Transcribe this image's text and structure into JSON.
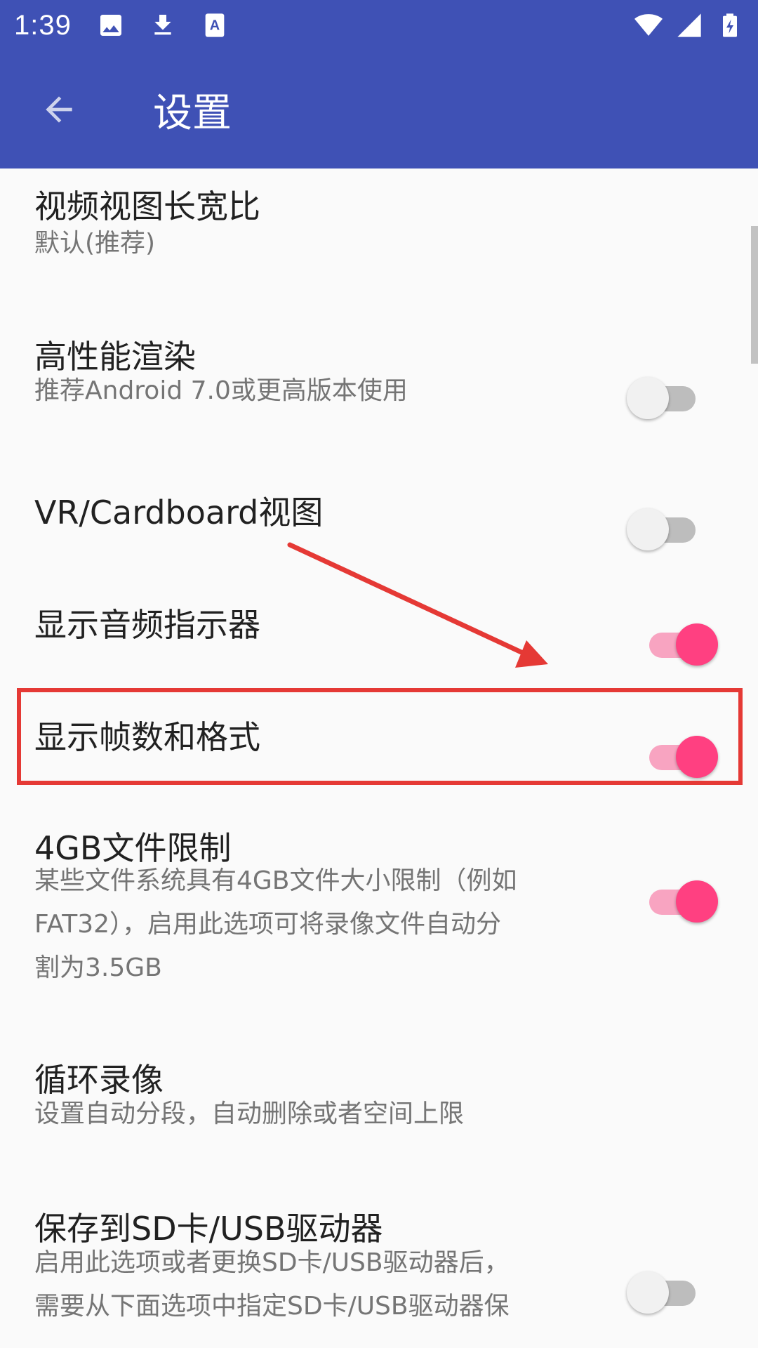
{
  "status_bar": {
    "time": "1:39",
    "left_icons": [
      "image-icon",
      "download-icon",
      "text-a-icon"
    ],
    "right_icons": [
      "wifi-icon",
      "signal-icon",
      "battery-charging-icon"
    ]
  },
  "app_bar": {
    "title": "设置",
    "back_icon": "arrow-back-icon"
  },
  "settings": [
    {
      "title": "视频视图长宽比",
      "summary": "默认(推荐)",
      "switch": null
    },
    {
      "title": "高性能渲染",
      "summary": "推荐Android 7.0或更高版本使用",
      "switch": false
    },
    {
      "title": "VR/Cardboard视图",
      "summary": "",
      "switch": false
    },
    {
      "title": "显示音频指示器",
      "summary": "",
      "switch": true
    },
    {
      "title": "显示帧数和格式",
      "summary": "",
      "switch": true
    },
    {
      "title": "4GB文件限制",
      "summary": [
        "某些文件系统具有4GB文件大小限制（例如",
        "FAT32），启用此选项可将录像文件自动分",
        "割为3.5GB"
      ],
      "switch": true
    },
    {
      "title": "循环录像",
      "summary": "设置自动分段，自动删除或者空间上限",
      "switch": null
    },
    {
      "title": "保存到SD卡/USB驱动器",
      "summary": [
        "启用此选项或者更换SD卡/USB驱动器后，",
        "需要从下面选项中指定SD卡/USB驱动器保"
      ],
      "switch": false
    }
  ],
  "colors": {
    "primary": "#3f51b5",
    "accent": "#ff4081",
    "annotation": "#e53935"
  }
}
